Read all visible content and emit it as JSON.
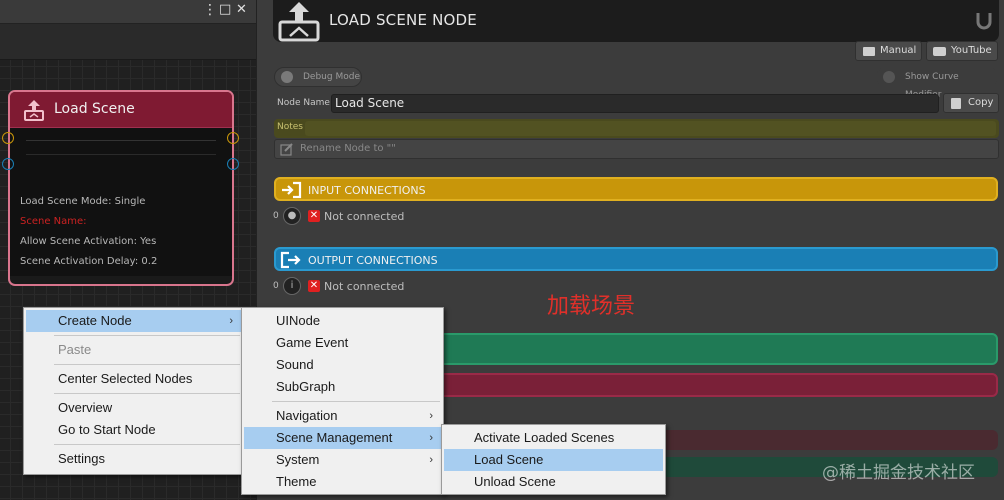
{
  "graph": {
    "window_controls": {
      "more": "⋮",
      "maximize": "□",
      "close": "✕"
    },
    "node": {
      "title": "Load Scene",
      "lines": [
        "Load Scene Mode: Single",
        "Scene Name:",
        "Allow Scene Activation: Yes",
        "Scene Activation Delay: 0.2"
      ],
      "colors": {
        "header": "#7f1a32",
        "border": "#d9758d",
        "warning": "#cc2222"
      }
    }
  },
  "inspector": {
    "title": "LOAD SCENE NODE",
    "buttons": {
      "manual": "Manual",
      "youtube": "YouTube",
      "copy": "Copy"
    },
    "toggles": {
      "debug": "Debug Mode",
      "curve": "Show Curve Modifier"
    },
    "node_name_label": "Node Name",
    "node_name_value": "Load Scene",
    "notes_label": "Notes",
    "rename_placeholder": "Rename Node to \"\"",
    "input": {
      "title": "INPUT CONNECTIONS",
      "count": "0",
      "status": "Not connected",
      "color": "#c8960a"
    },
    "output": {
      "title": "OUTPUT CONNECTIONS",
      "count": "0",
      "status": "Not connected",
      "color": "#1a7fb5"
    },
    "section_colors": [
      "#1f7a55",
      "#7a2038",
      "#4a2a30",
      "#1f4a3a"
    ]
  },
  "annotation": "加载场景",
  "menu": {
    "items": [
      "Create Node",
      "Paste",
      "Center Selected Nodes",
      "Overview",
      "Go to Start Node",
      "Settings"
    ],
    "selected": "Create Node",
    "disabled": "Paste"
  },
  "submenu": {
    "items": [
      "UINode",
      "Game Event",
      "Sound",
      "SubGraph",
      "Navigation",
      "Scene Management",
      "System",
      "Theme"
    ],
    "selected": "Scene Management"
  },
  "submenu2": {
    "items": [
      "Activate Loaded Scenes",
      "Load Scene",
      "Unload Scene"
    ],
    "selected": "Load Scene"
  },
  "watermark": "@稀土掘金技术社区"
}
